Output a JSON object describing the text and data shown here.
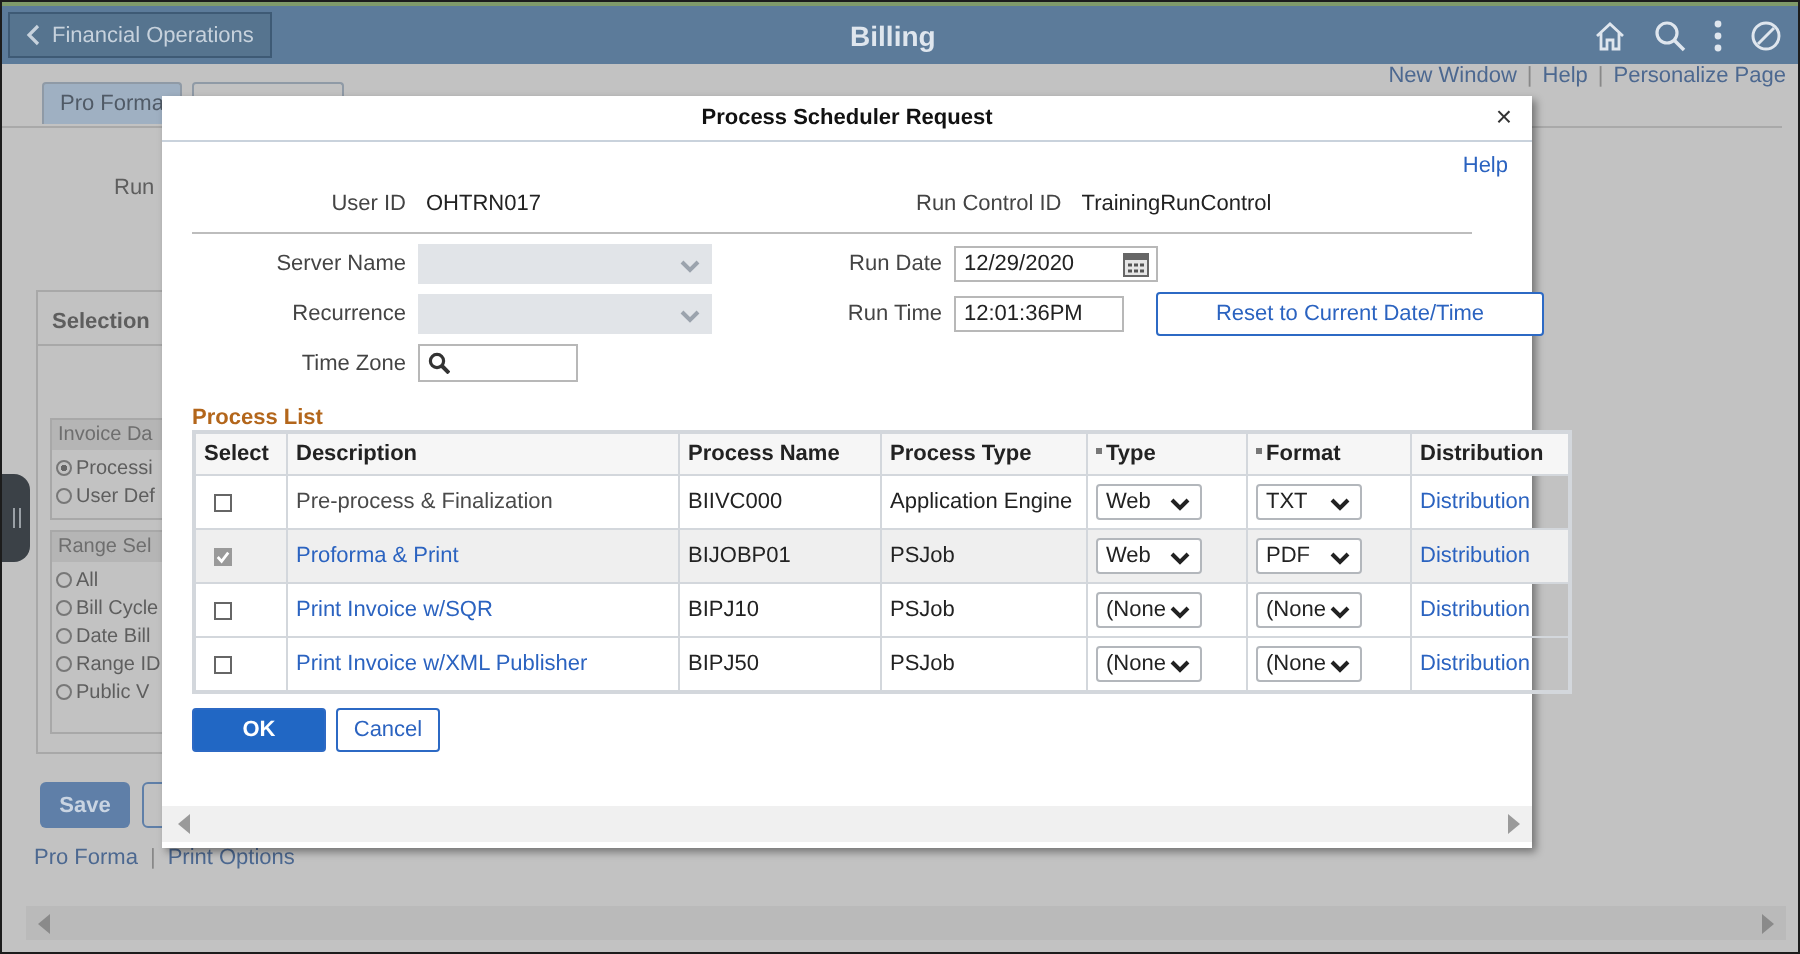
{
  "header": {
    "back_button": "Financial Operations",
    "title": "Billing"
  },
  "page_links": [
    {
      "kind": "link",
      "text": "New Window"
    },
    {
      "kind": "separator",
      "text": "|"
    },
    {
      "kind": "link",
      "text": "Help"
    },
    {
      "kind": "separator",
      "text": "|"
    },
    {
      "kind": "link",
      "text": "Personalize Page"
    }
  ],
  "tabs": [
    {
      "label": "Pro Forma",
      "selected": true
    }
  ],
  "run_label": "Run",
  "selection_panel": {
    "title": "Selection",
    "groups": [
      {
        "title": "Invoice Da",
        "options": [
          {
            "label": "Processi",
            "selected": true
          },
          {
            "label": "User Def",
            "selected": false
          }
        ]
      },
      {
        "title": "Range Sel",
        "options": [
          {
            "label": "All",
            "selected": false
          },
          {
            "label": "Bill Cycle",
            "selected": false
          },
          {
            "label": "Date Bill",
            "selected": false
          },
          {
            "label": "Range ID",
            "selected": false
          },
          {
            "label": "Public V",
            "selected": false
          }
        ]
      }
    ]
  },
  "page_buttons": [
    "Save"
  ],
  "footer_links": [
    {
      "kind": "link",
      "text": "Pro Forma"
    },
    {
      "kind": "separator",
      "text": "|"
    },
    {
      "kind": "link",
      "text": "Print Options"
    }
  ],
  "dialog": {
    "title": "Process Scheduler Request",
    "close": "×",
    "help": "Help",
    "user_id": {
      "label": "User ID",
      "value": "OHTRN017"
    },
    "run_control_id": {
      "label": "Run Control ID",
      "value": "TrainingRunControl"
    },
    "server_name": {
      "label": "Server Name",
      "disabled": true
    },
    "recurrence": {
      "label": "Recurrence",
      "disabled": true
    },
    "time_zone": {
      "label": "Time Zone"
    },
    "run_date": {
      "label": "Run Date",
      "value": "12/29/2020"
    },
    "run_time": {
      "label": "Run Time",
      "value": "12:01:36PM"
    },
    "reset_button": "Reset to Current Date/Time",
    "process_list": {
      "title": "Process List",
      "columns": [
        {
          "label": "Select",
          "required": false
        },
        {
          "label": "Description",
          "required": false
        },
        {
          "label": "Process Name",
          "required": false
        },
        {
          "label": "Process Type",
          "required": false
        },
        {
          "label": "Type",
          "required": true
        },
        {
          "label": "Format",
          "required": true
        },
        {
          "label": "Distribution",
          "required": false
        }
      ],
      "rows": [
        {
          "selected": false,
          "description": "Pre-process & Finalization",
          "link": false,
          "process_name": "BIIVC000",
          "process_type": "Application Engine",
          "type": "Web",
          "format": "TXT",
          "distribution": "Distribution"
        },
        {
          "selected": true,
          "description": "Proforma & Print",
          "link": true,
          "process_name": "BIJOBP01",
          "process_type": "PSJob",
          "type": "Web",
          "format": "PDF",
          "distribution": "Distribution"
        },
        {
          "selected": false,
          "description": "Print Invoice w/SQR",
          "link": true,
          "process_name": "BIPJ10",
          "process_type": "PSJob",
          "type": "(None",
          "format": "(None",
          "distribution": "Distribution"
        },
        {
          "selected": false,
          "description": "Print Invoice w/XML Publisher",
          "link": true,
          "process_name": "BIPJ50",
          "process_type": "PSJob",
          "type": "(None",
          "format": "(None",
          "distribution": "Distribution"
        }
      ]
    },
    "buttons": [
      {
        "label": "OK",
        "primary": true
      },
      {
        "label": "Cancel",
        "primary": false
      }
    ]
  }
}
